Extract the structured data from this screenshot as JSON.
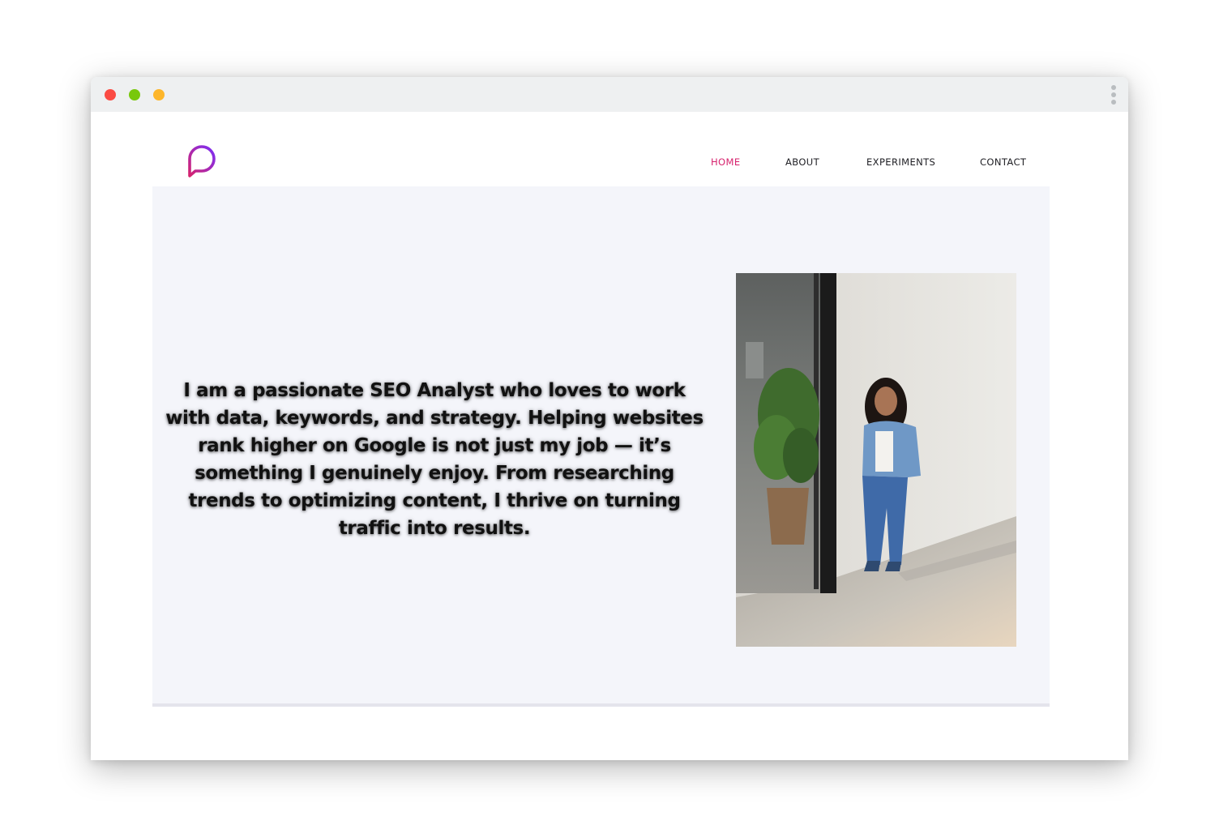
{
  "window": {
    "controls": [
      "close",
      "minimize",
      "maximize"
    ],
    "menu_icon": "kebab-menu-icon"
  },
  "logo": {
    "icon": "speech-bubble-logo-icon",
    "colors": [
      "#d6236e",
      "#7b2ff7"
    ]
  },
  "nav": {
    "items": [
      {
        "label": "HOME",
        "active": true
      },
      {
        "label": "ABOUT",
        "active": false
      },
      {
        "label": "EXPERIMENTS",
        "active": false
      },
      {
        "label": "CONTACT",
        "active": false
      }
    ],
    "active_color": "#d6236e",
    "text_color": "#1f1f24"
  },
  "hero": {
    "bio": "I am a passionate SEO Analyst who loves to work with data, keywords, and strategy. Helping websites rank higher on Google is not just my job — it’s something I genuinely enjoy. From researching trends to optimizing content, I thrive on turning traffic into results.",
    "background": "#f4f5fa",
    "photo": {
      "description": "profile-photo"
    }
  }
}
